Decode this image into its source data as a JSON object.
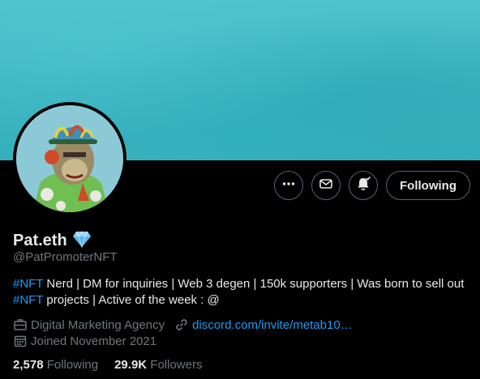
{
  "profile": {
    "display_name": "Pat.eth",
    "handle": "@PatPromoterNFT",
    "bio_line1_tag": "#NFT",
    "bio_line1_rest": " Nerd | DM for inquiries | Web 3 degen | 150k supporters | Was born to sell out",
    "bio_line2_tag": "#NFT",
    "bio_line2_rest": " projects | Active of the week : @",
    "category": "Digital Marketing Agency",
    "link": "discord.com/invite/metab10…",
    "joined": "Joined November 2021"
  },
  "actions": {
    "follow_label": "Following"
  },
  "stats": {
    "following_count": "2,578",
    "following_label": "Following",
    "followers_count": "29.9K",
    "followers_label": "Followers"
  },
  "icons": {
    "more": "more-icon",
    "message": "message-icon",
    "notify": "notification-bell-icon",
    "verified": "diamond-icon",
    "category": "briefcase-icon",
    "link": "link-icon",
    "calendar": "calendar-icon"
  },
  "colors": {
    "accent": "#1d9bf0",
    "banner": "#3db5c2",
    "background": "#000000",
    "secondary_text": "#71767b"
  }
}
